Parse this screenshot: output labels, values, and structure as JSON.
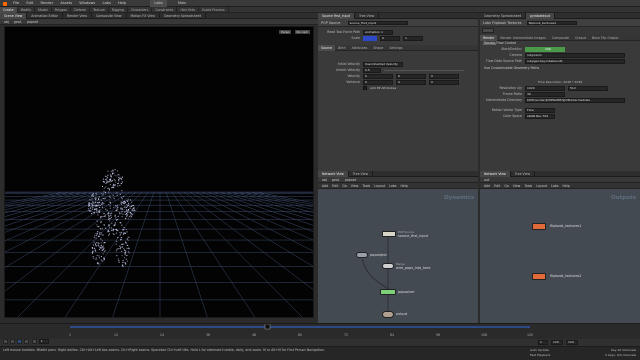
{
  "menubar": {
    "items": [
      "File",
      "Edit",
      "Render",
      "Assets",
      "Windows",
      "Labs",
      "Help"
    ],
    "desktop_tabs": [
      "Labs",
      "Main"
    ]
  },
  "shelf_tabs": [
    "Create",
    "Modify",
    "Model",
    "Polygon",
    "Deform",
    "Texture",
    "Rigging",
    "Characters",
    "Constraints",
    "Hair Utils",
    "Guide Process"
  ],
  "scene_view": {
    "tabs": [
      "Scene View",
      "Animation Editor",
      "Render View",
      "Composite View",
      "Motion FX View",
      "Geometry Spreadsheet"
    ],
    "path": [
      "obj",
      "geo1",
      "popnet"
    ],
    "persp": "Persp",
    "cam": "No cam"
  },
  "params_left": {
    "tabs": [
      "Source first_input",
      "Tree View"
    ],
    "node_type": "POP Source",
    "node_name": "source_first_input",
    "frame_label": "Read Tool Force Path",
    "frame_value": "animation 1",
    "scale_label": "Scale",
    "scale_value": "0",
    "scale_value2": "1",
    "subtabs": [
      "Source",
      "Birth",
      "Attributes",
      "Shape",
      "Settings"
    ],
    "rows": [
      {
        "label": "Initial Velocity",
        "value": "Use Inherited Velocity"
      },
      {
        "label": "Inherit Velocity",
        "value": "0.5"
      },
      {
        "label": "Velocity",
        "v1": "0",
        "v2": "0",
        "v3": "0"
      },
      {
        "label": "Variance",
        "v1": "0",
        "v2": "0",
        "v3": "0"
      }
    ],
    "checkbox_label": "Add PP Attributes"
  },
  "params_right": {
    "tabs": [
      "Geometry Spreadsheet",
      "pyrobakeout"
    ],
    "node_type": "Labs Flipbook Textures",
    "node_name": "flipbook_textures1",
    "subtabs": [
      "Render",
      "Render Intermediate Images",
      "Composite",
      "Output",
      "Base Flip Output",
      "Controls"
    ],
    "section_title": "Render Flow Control",
    "rows": [
      {
        "label": "Start/End/Inc",
        "value": "100"
      },
      {
        "label": "Camera",
        "value": "/obj/cam1"
      },
      {
        "label": "Flow Data Source Path",
        "value": "/obj/geo1/pyrobakeout1"
      }
    ],
    "section2": "Use Customizable Geometry Paths",
    "flow_resolution": "Flow Resolution: 2048 * 2048",
    "rows2": [
      {
        "label": "Resolution x/y",
        "v1": "1024",
        "v2": "512"
      },
      {
        "label": "Frame Ratio",
        "v1": "30"
      },
      {
        "label": "Intermediate Directory",
        "v1": "$HIP/render/$HIPNAME/$JOB/intermediate"
      }
    ],
    "extra_rows": [
      {
        "label": "Motion Vector Type",
        "value": "Flow"
      },
      {
        "label": "Color Space",
        "value": "sRGB Rec.709"
      }
    ]
  },
  "network_left": {
    "tabs": [
      "Network View",
      "Tree View"
    ],
    "path": [
      "obj",
      "geo1",
      "popnet"
    ],
    "menu": [
      "Add",
      "Edit",
      "Go",
      "View",
      "Tools",
      "Layout",
      "Labs",
      "Help"
    ],
    "context_label": "Dynamics",
    "nodes": [
      {
        "name": "source_first_input",
        "sub": "POP Source",
        "color": "#d8d6c8"
      },
      {
        "name": "popobject",
        "sub": "",
        "color": "#9aa0a8"
      },
      {
        "name": "wire_pops_into_here",
        "sub": "Merge",
        "color": "#cfcfcf"
      },
      {
        "name": "popsolver",
        "sub": "",
        "color": "#7fd07a"
      },
      {
        "name": "output",
        "sub": "",
        "color": "#b0a08f"
      }
    ]
  },
  "network_right": {
    "tabs": [
      "Network View",
      "Tree View"
    ],
    "path": [
      "out"
    ],
    "menu": [
      "Add",
      "Edit",
      "Go",
      "View",
      "Tools",
      "Layout",
      "Labs",
      "Help"
    ],
    "context_label": "Outputs",
    "nodes": [
      {
        "name": "flipbook_textures1",
        "color": "#e06a3a"
      },
      {
        "name": "flipbook_textures2",
        "color": "#e06a3a"
      }
    ]
  },
  "timeline": {
    "current_frame": "1",
    "start": "1",
    "end": "120",
    "ticks": [
      "1",
      "12",
      "24",
      "36",
      "48",
      "60",
      "72",
      "84",
      "96",
      "108",
      "120"
    ],
    "end_fields": [
      "1",
      "120",
      "120"
    ],
    "auto_update": "Auto Update"
  },
  "status": {
    "message": "Left mouse tumbles. Middle pans. Right dollies. Ctrl+Alt+Left box zooms. Ctrl+Right zooms. Spacebar Ctrl+Left tilts. Hold L for alternate tumble, dolly, and zoom.    M or Alt+M for First Person Navigation.",
    "key_all": "Key All Channels",
    "keys": "0 keys, 0/0 channels",
    "playback": "Fast Playback"
  },
  "colors": {
    "viewport_bg": "#030303",
    "grid": "#3a4a6a",
    "particles": "#c9cdf0",
    "accent": "#ff6a00",
    "timeline_bar": "#2c4b86"
  }
}
